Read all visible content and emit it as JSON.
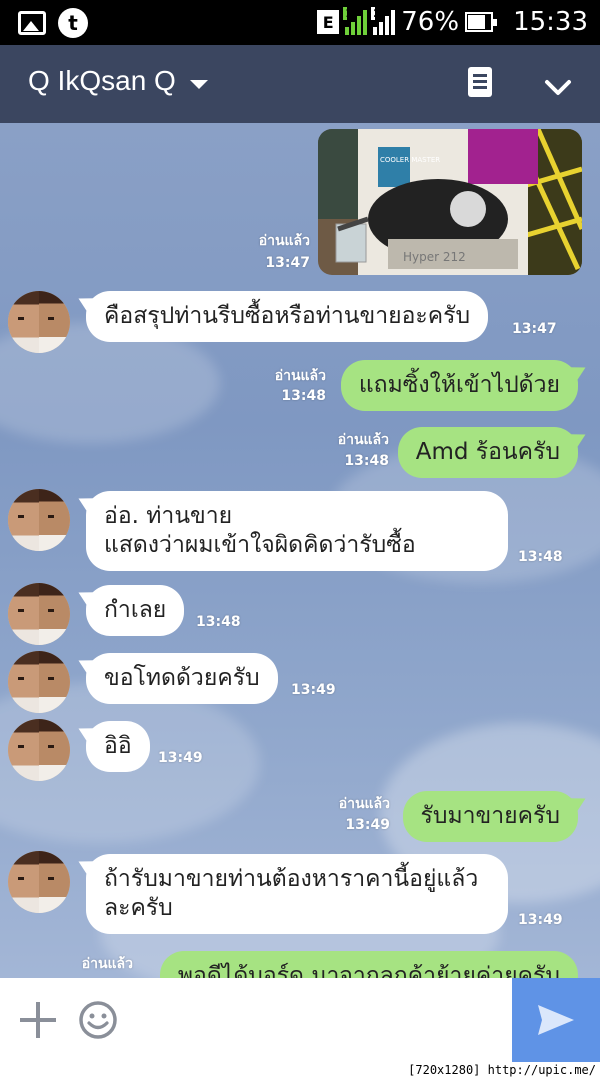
{
  "status_bar": {
    "network_type": "E",
    "sim1": "1",
    "sim2": "2",
    "battery_percent": "76%",
    "time": "15:33"
  },
  "header": {
    "title": "Q IkQsan Q"
  },
  "messages": [
    {
      "kind": "image",
      "from": "me",
      "read": "อ่านแล้ว",
      "time": "13:47",
      "image_text": [
        "COOLER MASTER",
        "Hyper 212"
      ]
    },
    {
      "kind": "text",
      "from": "them",
      "text": "คือสรุปท่านรีบซื้อหรือท่านขายอะครับ",
      "time": "13:47"
    },
    {
      "kind": "text",
      "from": "me",
      "text": "แถมซิ้งให้เข้าไปด้วย",
      "read": "อ่านแล้ว",
      "time": "13:48"
    },
    {
      "kind": "text",
      "from": "me",
      "text": "Amd ร้อนครับ",
      "read": "อ่านแล้ว",
      "time": "13:48"
    },
    {
      "kind": "text",
      "from": "them",
      "line1": "อ่อ. ท่านขาย",
      "line2": "แสดงว่าผมเข้าใจผิดคิดว่ารับซื้อ",
      "time": "13:48"
    },
    {
      "kind": "text",
      "from": "them",
      "text": "กำเลย",
      "time": "13:48"
    },
    {
      "kind": "text",
      "from": "them",
      "text": "ขอโทดด้วยครับ",
      "time": "13:49"
    },
    {
      "kind": "text",
      "from": "them",
      "text": "อิอิ",
      "time": "13:49"
    },
    {
      "kind": "text",
      "from": "me",
      "text": "รับมาขายครับ",
      "read": "อ่านแล้ว",
      "time": "13:49"
    },
    {
      "kind": "text",
      "from": "them",
      "line1": "ถ้ารับมาขายท่านต้องหาราคานี้อยู่แล้ว",
      "line2": "ละครับ",
      "time": "13:49"
    },
    {
      "kind": "text",
      "from": "me",
      "text": "พอดีได้บอร์ด มาจากลูกค้าย้ายค่ายครับ",
      "read": "อ่านแล้ว"
    }
  ],
  "input": {
    "placeholder": ""
  },
  "watermark": "[720x1280] http://upic.me/",
  "colors": {
    "header": "#3b4660",
    "outgoing_bubble": "#a6e382",
    "incoming_bubble": "#ffffff",
    "send_button": "#5f93e6"
  }
}
